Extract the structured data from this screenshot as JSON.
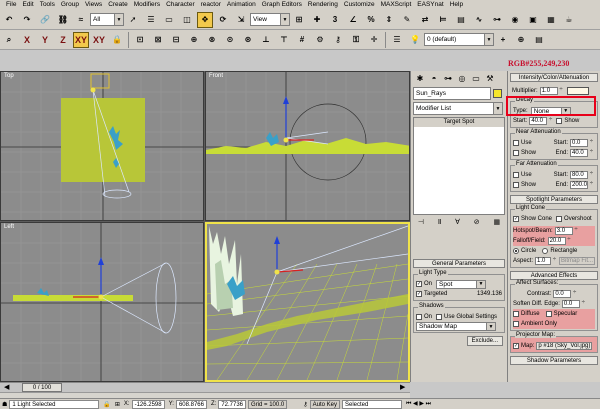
{
  "menu": [
    "File",
    "Edit",
    "Tools",
    "Group",
    "Views",
    "Create",
    "Modifiers",
    "Character",
    "reactor",
    "Animation",
    "Graph Editors",
    "Rendering",
    "Customize",
    "MAXScript",
    "EASYnat",
    "Help"
  ],
  "toolbar1": {
    "selection_filter": "All",
    "reference_coord": "View"
  },
  "toolbar2": {
    "axes": [
      "X",
      "Y",
      "Z",
      "XY",
      "XY"
    ],
    "layer": "0 (default)"
  },
  "viewports": {
    "top": "Top",
    "front": "Front",
    "left": "Left",
    "perspective": ""
  },
  "create_panel": {
    "object_name": "Sun_Rays",
    "object_color": "#f5e62a",
    "modifier_list": "Modifier List",
    "stack_item": "Target Spot",
    "general_params": {
      "title": "General Parameters",
      "light_type_label": "Light Type",
      "on_label": "On",
      "light_type": "Spot",
      "targeted_label": "Targeted",
      "target_distance": "1349.136",
      "shadows_label": "Shadows",
      "shadows_on_label": "On",
      "use_global_label": "Use Global Settings",
      "shadow_type": "Shadow Map",
      "exclude_label": "Exclude..."
    }
  },
  "right_panel": {
    "rgb_annotation": "RGB#255,249,230",
    "intensity": {
      "title": "Intensity/Color/Attenuation",
      "multiplier_label": "Multiplier:",
      "multiplier": "1.0",
      "multiplier_color": "#fff9e6",
      "decay_label": "Decay",
      "type_label": "Type:",
      "type": "None",
      "start_label": "Start:",
      "start": "40.0",
      "show_label": "Show",
      "near_label": "Near Attenuation",
      "near_use": "Use",
      "near_start_label": "Start:",
      "near_start": "0.0",
      "near_show": "Show",
      "near_end_label": "End:",
      "near_end": "40.0",
      "far_label": "Far Attenuation",
      "far_use": "Use",
      "far_start_label": "Start:",
      "far_start": "80.0",
      "far_show": "Show",
      "far_end_label": "End:",
      "far_end": "200.0"
    },
    "spotlight": {
      "title": "Spotlight Parameters",
      "light_cone_label": "Light Cone",
      "show_cone": "Show Cone",
      "overshoot": "Overshoot",
      "hotspot_label": "Hotspot/Beam:",
      "hotspot": "3.0",
      "falloff_label": "Falloff/Field:",
      "falloff": "20.0",
      "circle": "Circle",
      "rectangle": "Rectangle",
      "aspect_label": "Aspect:",
      "aspect": "1.0",
      "bitmap_fit": "Bitmap Fit..."
    },
    "advanced": {
      "title": "Advanced Effects",
      "affect_surfaces": "Affect Surfaces:",
      "contrast_label": "Contrast:",
      "contrast": "0.0",
      "soften_label": "Soften Diff. Edge:",
      "soften": "0.0",
      "diffuse": "Diffuse",
      "specular": "Specular",
      "ambient_only": "Ambient Only",
      "projector_label": "Projector Map:",
      "map_label": "Map:",
      "map_value": "p #18 (Sky_Vol.jpg)"
    },
    "shadow_params_title": "Shadow Parameters"
  },
  "timeline": {
    "frame": "0 / 100"
  },
  "status": {
    "selection": "1 Light Selected",
    "x_label": "X:",
    "x": "-126.2598",
    "y_label": "Y:",
    "y": "608.8766",
    "z_label": "Z:",
    "z": "72.7736",
    "grid": "Grid = 100.0",
    "auto_key": "Auto Key",
    "selected": "Selected"
  }
}
